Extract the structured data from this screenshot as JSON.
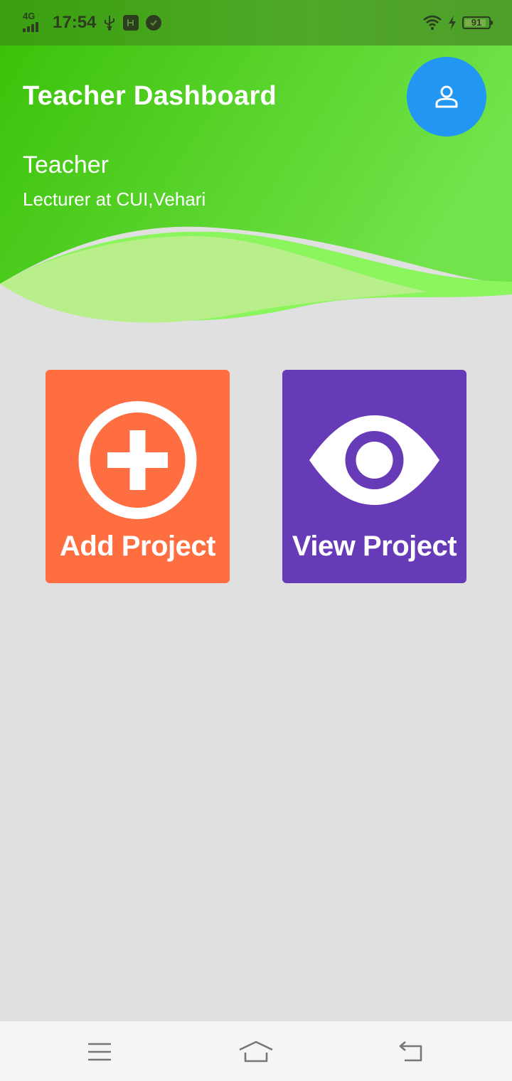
{
  "status_bar": {
    "network": "4G",
    "time": "17:54",
    "battery": "91",
    "battery_level": 0.91
  },
  "header": {
    "title": "Teacher Dashboard",
    "user_name": "Teacher",
    "user_role": "Lecturer at CUI,Vehari",
    "avatar_icon": "person-icon"
  },
  "cards": {
    "add": {
      "label": "Add Project",
      "icon": "add-circle-icon",
      "color": "#ff6e40"
    },
    "view": {
      "label": "View Project",
      "icon": "eye-icon",
      "color": "#673ab7"
    }
  },
  "colors": {
    "header_green": "#3cc20a",
    "wave_light": "#b9ef8a",
    "avatar_blue": "#2196f3",
    "background": "#e0e0e0"
  },
  "nav_bar": {
    "items": [
      "menu-icon",
      "home-icon",
      "back-icon"
    ]
  }
}
